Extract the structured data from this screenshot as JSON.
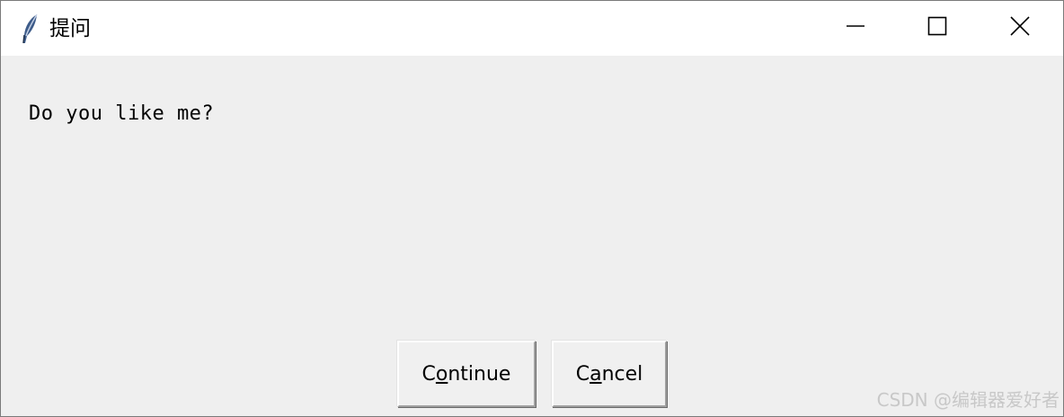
{
  "window": {
    "title": "提问",
    "icon": "feather-icon",
    "controls": [
      "minimize-icon",
      "maximize-icon",
      "close-icon"
    ]
  },
  "dialog": {
    "message": "Do you like me?",
    "buttons": {
      "continue": {
        "label": "Continue",
        "prefix": "C",
        "mnemonic": "o",
        "suffix": "ntinue"
      },
      "cancel": {
        "label": "Cancel",
        "prefix": "C",
        "mnemonic": "a",
        "suffix": "ncel"
      }
    }
  },
  "watermark": "CSDN @编辑器爱好者",
  "colors": {
    "titlebar": "#ffffff",
    "content_bg": "#efefef",
    "window_border": "#7a7a7a"
  }
}
